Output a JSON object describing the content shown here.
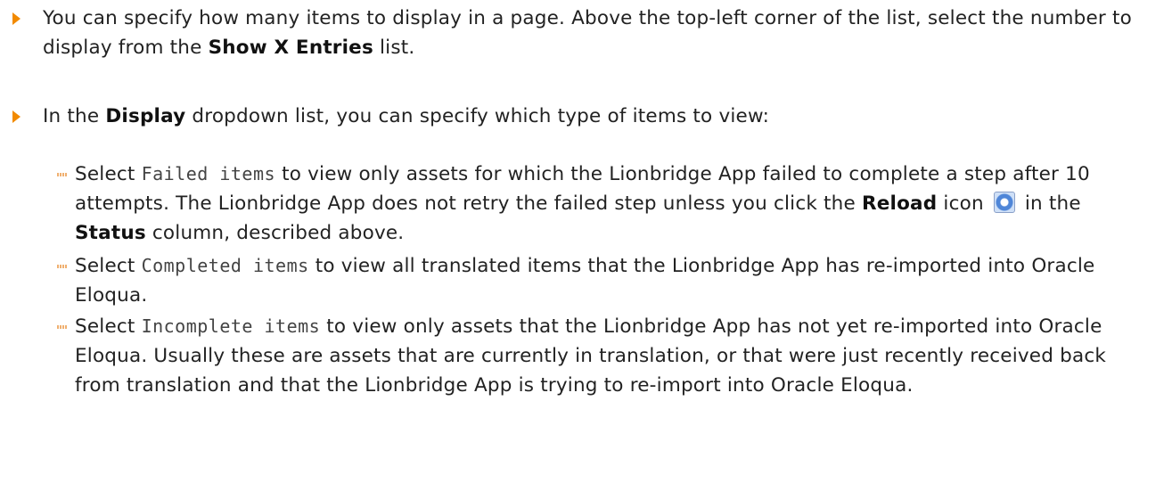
{
  "bullets": [
    {
      "t1": "You can specify how many items to display in a page. Above the top-left corner of the list, select the number to display from the ",
      "b1": "Show X Entries",
      "t2": " list."
    },
    {
      "t1": "In the ",
      "b1": "Display",
      "t2": " dropdown list, you can specify which type of items to view:"
    }
  ],
  "subbullets": [
    {
      "select": "Select ",
      "code": "Failed items",
      "t1": " to view only assets for which the Lionbridge App failed to complete a step after 10 attempts. The Lionbridge App does not retry the failed step unless you click the ",
      "b1": "Reload",
      "t2": " icon ",
      "t3": " in the ",
      "b2": "Status",
      "t4": " column, described above.",
      "icon": "reload-icon"
    },
    {
      "select": "Select ",
      "code": "Completed items",
      "t1": " to view all translated items that the Lionbridge App has re-imported into Oracle Eloqua."
    },
    {
      "select": "Select ",
      "code": "Incomplete items",
      "t1": " to view only assets that the Lionbridge App has not yet re-imported into Oracle Eloqua. Usually these are assets that are currently in translation, or that were just recently received back from translation and that the Lionbridge App is trying to re-import into Oracle Eloqua."
    }
  ],
  "colors": {
    "bullet": "#f28a00",
    "text": "#222222"
  }
}
